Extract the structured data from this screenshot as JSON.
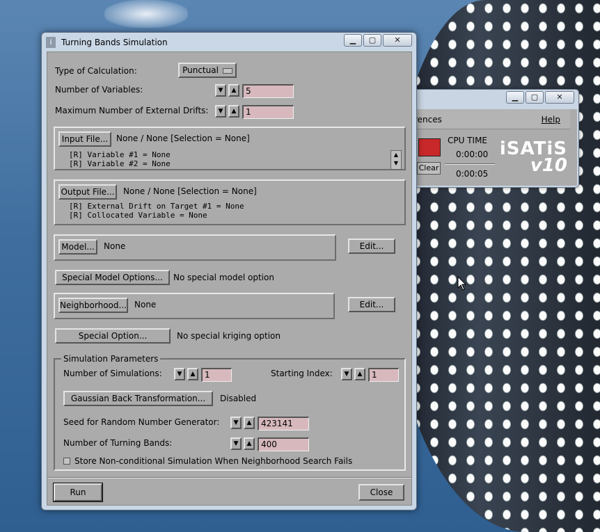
{
  "isatis": {
    "menu_left": "rences",
    "menu_help": "Help",
    "cpu_time_label": "CPU TIME",
    "time1": "0:00:00",
    "time2": "0:00:05",
    "clear": "Clear",
    "logo_name": "iSATiS",
    "logo_version": "v10"
  },
  "window": {
    "title": "Turning Bands Simulation",
    "min": "▁",
    "max": "▢",
    "close": "✕"
  },
  "top": {
    "type_label": "Type of Calculation:",
    "type_value": "Punctual",
    "nvars_label": "Number of Variables:",
    "nvars_value": "5",
    "ndrifts_label": "Maximum Number of External Drifts:",
    "ndrifts_value": "1"
  },
  "input": {
    "button": "Input File...",
    "summary": "None / None [Selection = None]",
    "line1": "[R] Variable #1 = None",
    "line2": "[R] Variable #2 = None"
  },
  "output": {
    "button": "Output File...",
    "summary": "None / None [Selection = None]",
    "line1": "[R] External Drift on Target #1 = None",
    "line2": "[R] Collocated Variable = None"
  },
  "model": {
    "button": "Model...",
    "value": "None",
    "edit": "Edit..."
  },
  "special_model": {
    "button": "Special Model Options...",
    "value": "No special model option"
  },
  "neighborhood": {
    "button": "Neighborhood...",
    "value": "None",
    "edit": "Edit..."
  },
  "special_option": {
    "button": "Special Option...",
    "value": "No special kriging option"
  },
  "sim": {
    "group_title": "Simulation Parameters",
    "nsim_label": "Number of Simulations:",
    "nsim_value": "1",
    "start_label": "Starting Index:",
    "start_value": "1",
    "gauss_button": "Gaussian Back Transformation...",
    "gauss_value": "Disabled",
    "seed_label": "Seed for Random Number Generator:",
    "seed_value": "423141",
    "bands_label": "Number of Turning Bands:",
    "bands_value": "400",
    "store_label": "Store Non-conditional Simulation When Neighborhood Search Fails"
  },
  "footer": {
    "run": "Run",
    "close": "Close"
  }
}
